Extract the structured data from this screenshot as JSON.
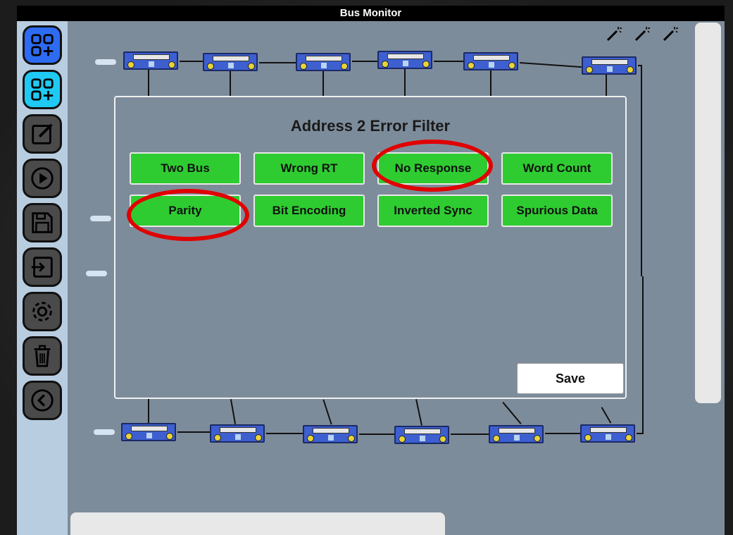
{
  "window": {
    "title": "Bus Monitor"
  },
  "sidebar": {
    "buttons": [
      {
        "icon": "add-grid-icon"
      },
      {
        "icon": "add-grid-icon"
      },
      {
        "icon": "edit-icon"
      },
      {
        "icon": "play-icon"
      },
      {
        "icon": "save-icon"
      },
      {
        "icon": "import-icon"
      },
      {
        "icon": "gear-icon"
      },
      {
        "icon": "trash-icon"
      },
      {
        "icon": "back-icon"
      }
    ]
  },
  "modal": {
    "title": "Address 2 Error Filter",
    "filters": [
      {
        "label": "Two Bus",
        "highlighted": false
      },
      {
        "label": "Wrong RT",
        "highlighted": false
      },
      {
        "label": "No Response",
        "highlighted": true
      },
      {
        "label": "Word Count",
        "highlighted": false
      },
      {
        "label": "Parity",
        "highlighted": true
      },
      {
        "label": "Bit Encoding",
        "highlighted": false
      },
      {
        "label": "Inverted Sync",
        "highlighted": false
      },
      {
        "label": "Spurious Data",
        "highlighted": false
      }
    ],
    "save_label": "Save"
  },
  "colors": {
    "filter_active": "#2ecc31",
    "highlight_ring": "#e00000",
    "coupler": "#3d5fd0"
  }
}
